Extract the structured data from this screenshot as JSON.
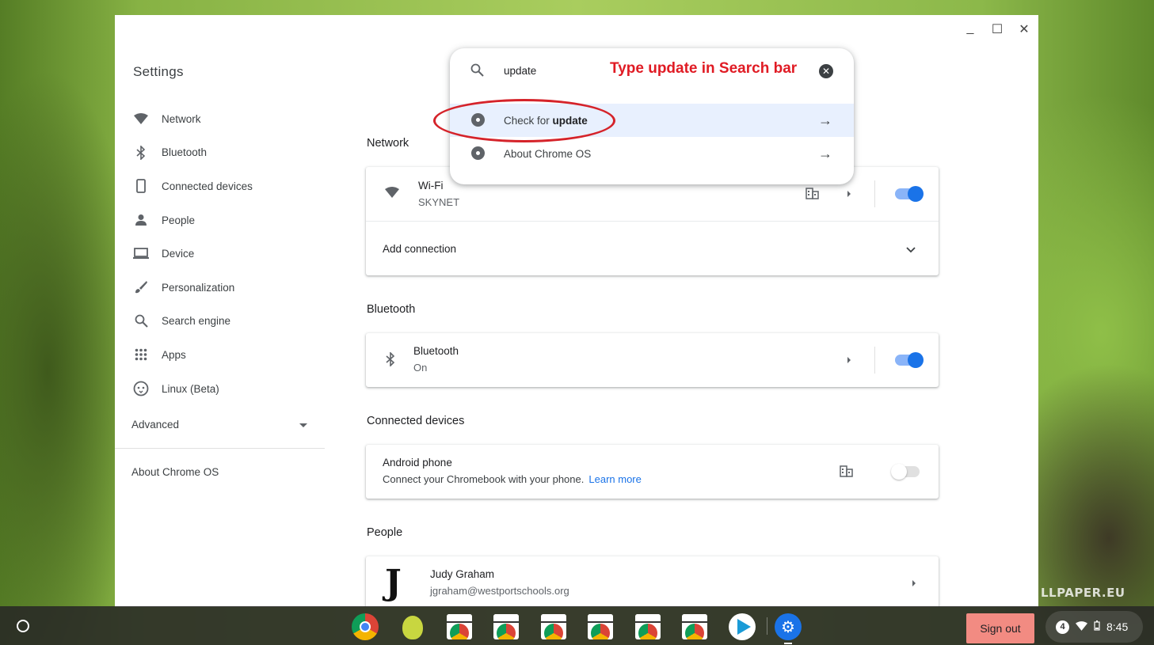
{
  "window": {
    "title": "Settings",
    "controls": {
      "minimize": "_",
      "maximize": "☐",
      "close": "✕"
    }
  },
  "sidebar": {
    "items": [
      {
        "label": "Network",
        "icon": "wifi-icon"
      },
      {
        "label": "Bluetooth",
        "icon": "bluetooth-icon"
      },
      {
        "label": "Connected devices",
        "icon": "phone-icon"
      },
      {
        "label": "People",
        "icon": "person-icon"
      },
      {
        "label": "Device",
        "icon": "laptop-icon"
      },
      {
        "label": "Personalization",
        "icon": "brush-icon"
      },
      {
        "label": "Search engine",
        "icon": "search-icon"
      },
      {
        "label": "Apps",
        "icon": "apps-grid-icon"
      },
      {
        "label": "Linux (Beta)",
        "icon": "linux-icon"
      }
    ],
    "advanced": "Advanced",
    "about": "About Chrome OS"
  },
  "search": {
    "query": "update",
    "annotation": "Type update in Search bar",
    "results": [
      {
        "prefix": "Check for ",
        "bold": "update"
      },
      {
        "prefix": "About Chrome OS",
        "bold": ""
      }
    ]
  },
  "main": {
    "network": {
      "title": "Network",
      "wifi_name": "Wi-Fi",
      "wifi_ssid": "SKYNET",
      "add_connection": "Add connection"
    },
    "bluetooth": {
      "title": "Bluetooth",
      "name": "Bluetooth",
      "status": "On"
    },
    "connected_devices": {
      "title": "Connected devices",
      "name": "Android phone",
      "desc": "Connect your Chromebook with your phone.",
      "link": "Learn more"
    },
    "people": {
      "title": "People",
      "avatar_letter": "J",
      "name": "Judy Graham",
      "email": "jgraham@westportschools.org"
    }
  },
  "shelf": {
    "sign_out": "Sign out",
    "notification_count": "4",
    "time": "8:45"
  },
  "wallpaper_watermark": "LLPAPER.EU",
  "colors": {
    "accent": "#1a73e8",
    "annotation_red": "#e01b24",
    "sign_out_bg": "#f28b82"
  }
}
